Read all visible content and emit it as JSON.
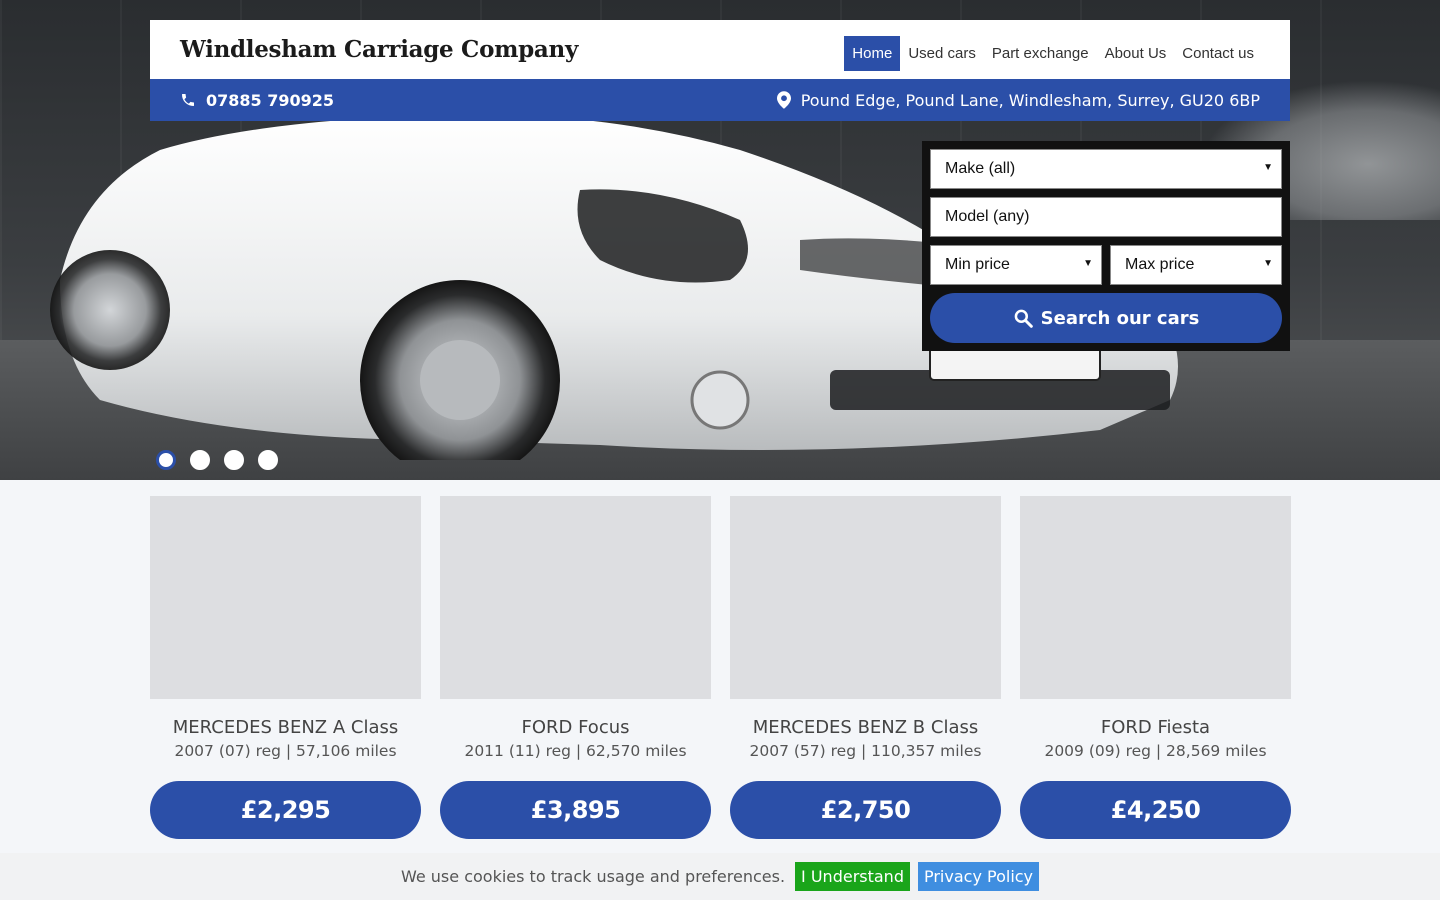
{
  "header": {
    "brand": "Windlesham Carriage Company",
    "nav": [
      {
        "label": "Home",
        "active": true
      },
      {
        "label": "Used cars",
        "active": false
      },
      {
        "label": "Part exchange",
        "active": false
      },
      {
        "label": "About Us",
        "active": false
      },
      {
        "label": "Contact us",
        "active": false
      }
    ]
  },
  "infobar": {
    "phone": "07885 790925",
    "address": "Pound Edge, Pound Lane, Windlesham, Surrey, GU20 6BP",
    "phone_icon": "phone-icon",
    "location_icon": "map-pin-icon"
  },
  "search": {
    "make": "Make (all)",
    "model": "Model (any)",
    "min_price": "Min price",
    "max_price": "Max price",
    "button": "Search our cars",
    "button_icon": "search-icon"
  },
  "slider": {
    "slide_count": 4,
    "active_index": 0
  },
  "listings": [
    {
      "title": "MERCEDES BENZ A Class",
      "meta": "2007 (07) reg | 57,106 miles",
      "price": "£2,295"
    },
    {
      "title": "FORD Focus",
      "meta": "2011 (11) reg | 62,570 miles",
      "price": "£3,895"
    },
    {
      "title": "MERCEDES BENZ B Class",
      "meta": "2007 (57) reg | 110,357 miles",
      "price": "£2,750"
    },
    {
      "title": "FORD Fiesta",
      "meta": "2009 (09) reg | 28,569 miles",
      "price": "£4,250"
    }
  ],
  "cookie": {
    "text": "We use cookies to track usage and preferences.",
    "accept": "I Understand",
    "policy": "Privacy Policy"
  },
  "colors": {
    "primary": "#2b4fa8",
    "accept": "#1aa51a",
    "policy": "#3f8ee0"
  }
}
